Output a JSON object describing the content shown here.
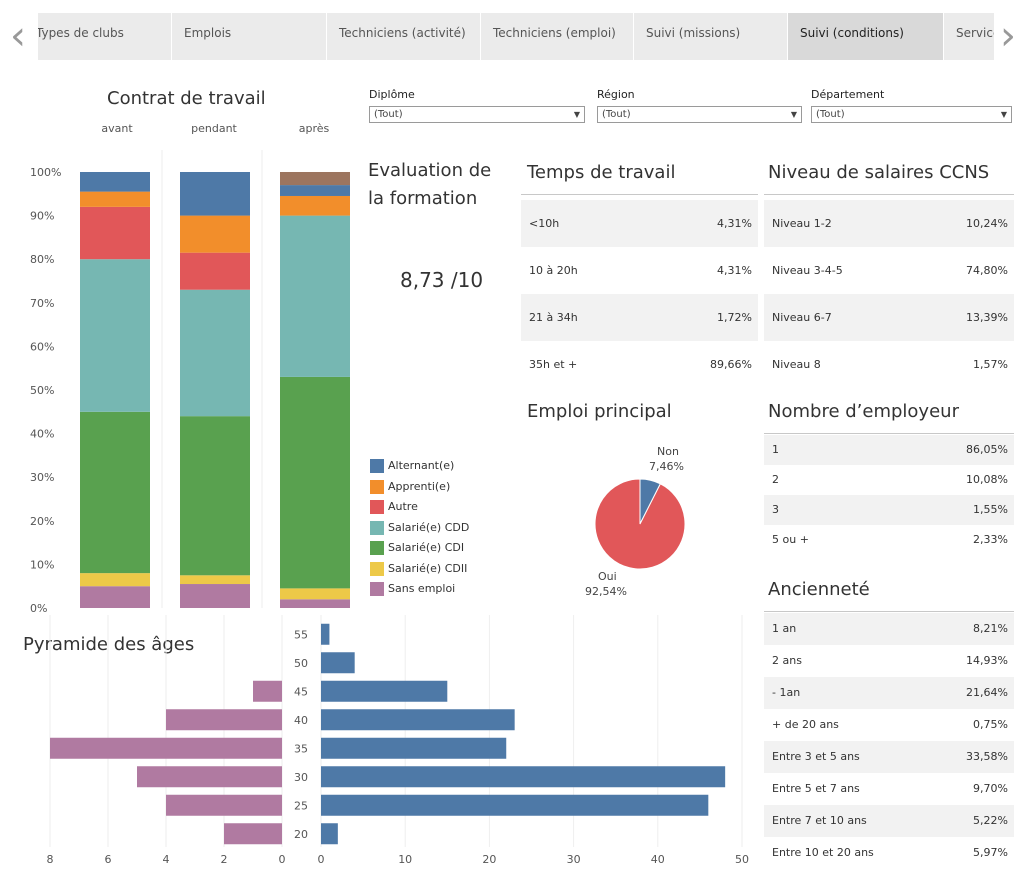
{
  "tabs": {
    "items": [
      "Types de clubs",
      "Emplois",
      "Techniciens (activité)",
      "Techniciens (emploi)",
      "Suivi (missions)",
      "Suivi (conditions)",
      "Services"
    ],
    "active_index": 5,
    "prev_icon": "chevron-left-icon",
    "next_icon": "chevron-right-icon"
  },
  "filters": {
    "diplome": {
      "label": "Diplôme",
      "value": "(Tout)"
    },
    "region": {
      "label": "Région",
      "value": "(Tout)"
    },
    "departement": {
      "label": "Département",
      "value": "(Tout)"
    }
  },
  "contrat": {
    "title": "Contrat de travail",
    "columns": [
      "avant",
      "pendant",
      "après"
    ],
    "yticks": [
      "100%",
      "90%",
      "80%",
      "70%",
      "60%",
      "50%",
      "40%",
      "30%",
      "20%",
      "10%",
      "0%"
    ]
  },
  "evaluation": {
    "title_line1": "Evaluation de",
    "title_line2": "la formation",
    "value": "8,73 /10"
  },
  "legend": [
    {
      "label": "Alternant(e)",
      "color": "#4e79a7"
    },
    {
      "label": "Apprenti(e)",
      "color": "#f28e2b"
    },
    {
      "label": "Autre",
      "color": "#e15759"
    },
    {
      "label": "Salarié(e) CDD",
      "color": "#76b7b2"
    },
    {
      "label": "Salarié(e) CDI",
      "color": "#59a14f"
    },
    {
      "label": "Salarié(e) CDII",
      "color": "#edc948"
    },
    {
      "label": "Sans emploi",
      "color": "#b07aa1"
    }
  ],
  "temps": {
    "title": "Temps de travail",
    "rows": [
      {
        "k": "<10h",
        "v": "4,31%"
      },
      {
        "k": "10 à 20h",
        "v": "4,31%"
      },
      {
        "k": "21 à 34h",
        "v": "1,72%"
      },
      {
        "k": "35h et +",
        "v": "89,66%"
      }
    ]
  },
  "salaires": {
    "title": "Niveau de salaires CCNS",
    "rows": [
      {
        "k": "Niveau 1-2",
        "v": "10,24%"
      },
      {
        "k": "Niveau 3-4-5",
        "v": "74,80%"
      },
      {
        "k": "Niveau 6-7",
        "v": "13,39%"
      },
      {
        "k": "Niveau 8",
        "v": "1,57%"
      }
    ]
  },
  "emploi": {
    "title": "Emploi principal",
    "non_label": "Non",
    "non_value": "7,46%",
    "oui_label": "Oui",
    "oui_value": "92,54%"
  },
  "employeur": {
    "title": "Nombre d’employeur",
    "rows": [
      {
        "k": "1",
        "v": "86,05%"
      },
      {
        "k": "2",
        "v": "10,08%"
      },
      {
        "k": "3",
        "v": "1,55%"
      },
      {
        "k": "5 ou +",
        "v": "2,33%"
      }
    ]
  },
  "anciennete": {
    "title": "Ancienneté",
    "rows": [
      {
        "k": "1 an",
        "v": "8,21%"
      },
      {
        "k": "2 ans",
        "v": "14,93%"
      },
      {
        "k": "- 1an",
        "v": "21,64%"
      },
      {
        "k": "+ de 20 ans",
        "v": "0,75%"
      },
      {
        "k": "Entre 3 et 5 ans",
        "v": "33,58%"
      },
      {
        "k": "Entre 5 et 7 ans",
        "v": "9,70%"
      },
      {
        "k": "Entre 7 et 10 ans",
        "v": "5,22%"
      },
      {
        "k": "Entre 10 et 20 ans",
        "v": "5,97%"
      }
    ]
  },
  "pyramide": {
    "title": "Pyramide des âges"
  },
  "chart_data": [
    {
      "type": "bar",
      "stacked": true,
      "title": "Contrat de travail",
      "categories": [
        "avant",
        "pendant",
        "après"
      ],
      "ylim": [
        0,
        100
      ],
      "series": [
        {
          "name": "Sans emploi",
          "color": "#b07aa1",
          "values": [
            5,
            5.5,
            2
          ]
        },
        {
          "name": "Salarié(e) CDII",
          "color": "#edc948",
          "values": [
            3,
            2,
            2.5
          ]
        },
        {
          "name": "Salarié(e) CDI",
          "color": "#59a14f",
          "values": [
            37,
            36.5,
            48.5
          ]
        },
        {
          "name": "Salarié(e) CDD",
          "color": "#76b7b2",
          "values": [
            35,
            29,
            37
          ]
        },
        {
          "name": "Autre",
          "color": "#e15759",
          "values": [
            12,
            8.5,
            0
          ]
        },
        {
          "name": "Apprenti(e)",
          "color": "#f28e2b",
          "values": [
            3.5,
            8.5,
            4.5
          ]
        },
        {
          "name": "Alternant(e)",
          "color": "#4e79a7",
          "values": [
            4.5,
            10,
            2.5
          ]
        },
        {
          "name": "",
          "color": "#9c755f",
          "values": [
            0,
            0,
            3
          ]
        }
      ]
    },
    {
      "type": "pie",
      "title": "Emploi principal",
      "labels": [
        "Non",
        "Oui"
      ],
      "values": [
        7.46,
        92.54
      ],
      "colors": [
        "#4e79a7",
        "#e15759"
      ]
    },
    {
      "type": "bar",
      "orientation": "horizontal",
      "title": "Pyramide des âges",
      "categories": [
        "55",
        "50",
        "45",
        "40",
        "35",
        "30",
        "25",
        "20"
      ],
      "series": [
        {
          "name": "",
          "color": "#b07aa1",
          "values": [
            0,
            0,
            1,
            4,
            8,
            5,
            4,
            2
          ]
        },
        {
          "name": "",
          "color": "#4e79a7",
          "values": [
            1,
            4,
            15,
            23,
            22,
            48,
            46,
            2
          ]
        }
      ],
      "left_ticks": [
        "8",
        "6",
        "4",
        "2",
        "0"
      ],
      "right_ticks": [
        "0",
        "10",
        "20",
        "30",
        "40",
        "50"
      ],
      "left_xlim": [
        0,
        8.5
      ],
      "right_xlim": [
        0,
        50
      ]
    }
  ]
}
